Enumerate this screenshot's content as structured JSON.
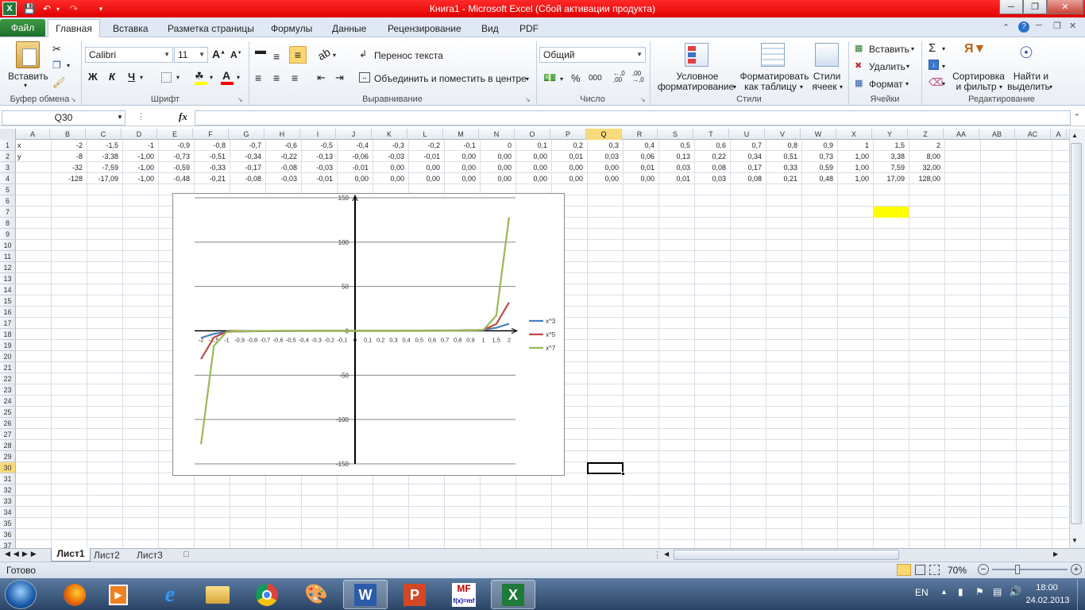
{
  "window": {
    "title": "Книга1  -  Microsoft Excel (Сбой активации продукта)"
  },
  "tabs": [
    "Файл",
    "Главная",
    "Вставка",
    "Разметка страницы",
    "Формулы",
    "Данные",
    "Рецензирование",
    "Вид",
    "PDF"
  ],
  "ribbon": {
    "paste_label": "Вставить",
    "font_name": "Calibri",
    "font_size": "11",
    "wrap_text": "Перенос текста",
    "merge_center": "Объединить и поместить в центре",
    "number_format": "Общий",
    "cond_format_1": "Условное",
    "cond_format_2": "форматирование",
    "format_table_1": "Форматировать",
    "format_table_2": "как таблицу",
    "cell_styles_1": "Стили",
    "cell_styles_2": "ячеек",
    "insert": "Вставить",
    "delete": "Удалить",
    "format": "Формат",
    "sort_1": "Сортировка",
    "sort_2": "и фильтр",
    "find_1": "Найти и",
    "find_2": "выделить",
    "bold": "Ж",
    "italic": "К",
    "underline": "Ч",
    "percent": "%",
    "thousands": "000",
    "groups": {
      "clipboard": "Буфер обмена",
      "font": "Шрифт",
      "alignment": "Выравнивание",
      "number": "Число",
      "styles": "Стили",
      "cells": "Ячейки",
      "editing": "Редактирование"
    }
  },
  "formula_bar": {
    "name_box": "Q30",
    "fx": "fx",
    "value": ""
  },
  "columns": [
    "A",
    "B",
    "C",
    "D",
    "E",
    "F",
    "G",
    "H",
    "I",
    "J",
    "K",
    "L",
    "M",
    "N",
    "O",
    "P",
    "Q",
    "R",
    "S",
    "T",
    "U",
    "V",
    "W",
    "X",
    "Y",
    "Z",
    "AA",
    "AB",
    "AC",
    "A"
  ],
  "rows": [
    "1",
    "2",
    "3",
    "4",
    "5",
    "6",
    "7",
    "8",
    "9",
    "10",
    "11",
    "12",
    "13",
    "14",
    "15",
    "16",
    "17",
    "18",
    "19",
    "20",
    "21",
    "22",
    "23",
    "24",
    "25",
    "26",
    "27",
    "28",
    "29",
    "30",
    "31",
    "32",
    "33",
    "34",
    "35",
    "36",
    "37"
  ],
  "sheet": {
    "labels": [
      "x",
      "y",
      "",
      ""
    ],
    "row1": [
      "-2",
      "-1,5",
      "-1",
      "-0,9",
      "-0,8",
      "-0,7",
      "-0,6",
      "-0,5",
      "-0,4",
      "-0,3",
      "-0,2",
      "-0,1",
      "0",
      "0,1",
      "0,2",
      "0,3",
      "0,4",
      "0,5",
      "0,6",
      "0,7",
      "0,8",
      "0,9",
      "1",
      "1,5",
      "2"
    ],
    "row2": [
      "-8",
      "-3,38",
      "-1,00",
      "-0,73",
      "-0,51",
      "-0,34",
      "-0,22",
      "-0,13",
      "-0,06",
      "-0,03",
      "-0,01",
      "0,00",
      "0,00",
      "0,00",
      "0,01",
      "0,03",
      "0,06",
      "0,13",
      "0,22",
      "0,34",
      "0,51",
      "0,73",
      "1,00",
      "3,38",
      "8,00"
    ],
    "row3": [
      "-32",
      "-7,59",
      "-1,00",
      "-0,59",
      "-0,33",
      "-0,17",
      "-0,08",
      "-0,03",
      "-0,01",
      "0,00",
      "0,00",
      "0,00",
      "0,00",
      "0,00",
      "0,00",
      "0,00",
      "0,01",
      "0,03",
      "0,08",
      "0,17",
      "0,33",
      "0,59",
      "1,00",
      "7,59",
      "32,00"
    ],
    "row4": [
      "-128",
      "-17,09",
      "-1,00",
      "-0,48",
      "-0,21",
      "-0,08",
      "-0,03",
      "-0,01",
      "0,00",
      "0,00",
      "0,00",
      "0,00",
      "0,00",
      "0,00",
      "0,00",
      "0,00",
      "0,00",
      "0,01",
      "0,03",
      "0,08",
      "0,21",
      "0,48",
      "1,00",
      "17,09",
      "128,00"
    ]
  },
  "chart_data": {
    "type": "line",
    "categories": [
      "-2",
      "-1,5",
      "-1",
      "-0,9",
      "-0,8",
      "-0,7",
      "-0,6",
      "-0,5",
      "-0,4",
      "-0,3",
      "-0,2",
      "-0,1",
      "0",
      "0,1",
      "0,2",
      "0,3",
      "0,4",
      "0,5",
      "0,6",
      "0,7",
      "0,8",
      "0,9",
      "1",
      "1,5",
      "2"
    ],
    "series": [
      {
        "name": "x^3",
        "color": "#4a7ebb",
        "values": [
          -8,
          -3.38,
          -1,
          -0.73,
          -0.51,
          -0.34,
          -0.22,
          -0.13,
          -0.06,
          -0.03,
          -0.01,
          0,
          0,
          0,
          0.01,
          0.03,
          0.06,
          0.13,
          0.22,
          0.34,
          0.51,
          0.73,
          1,
          3.38,
          8
        ]
      },
      {
        "name": "x^5",
        "color": "#be4b48",
        "values": [
          -32,
          -7.59,
          -1,
          -0.59,
          -0.33,
          -0.17,
          -0.08,
          -0.03,
          -0.01,
          0,
          0,
          0,
          0,
          0,
          0,
          0,
          0.01,
          0.03,
          0.08,
          0.17,
          0.33,
          0.59,
          1,
          7.59,
          32
        ]
      },
      {
        "name": "x^7",
        "color": "#98b954",
        "values": [
          -128,
          -17.09,
          -1,
          -0.48,
          -0.21,
          -0.08,
          -0.03,
          -0.01,
          0,
          0,
          0,
          0,
          0,
          0,
          0,
          0,
          0,
          0.01,
          0.03,
          0.08,
          0.21,
          0.48,
          1,
          17.09,
          128
        ]
      }
    ],
    "yticks": [
      "150",
      "100",
      "50",
      "0",
      "-50",
      "-100",
      "-150"
    ],
    "ylim": [
      -150,
      150
    ],
    "grid": true,
    "legend": "right"
  },
  "sheet_tabs": [
    "Лист1",
    "Лист2",
    "Лист3"
  ],
  "status": {
    "ready": "Готово",
    "zoom": "70%"
  },
  "taskbar": {
    "lang": "EN",
    "time": "18:00",
    "date": "24.02.2013"
  },
  "colors": {
    "title_bar": "#e00000",
    "file_tab": "#1d6f2a",
    "selected_fill": "#ffff00"
  }
}
